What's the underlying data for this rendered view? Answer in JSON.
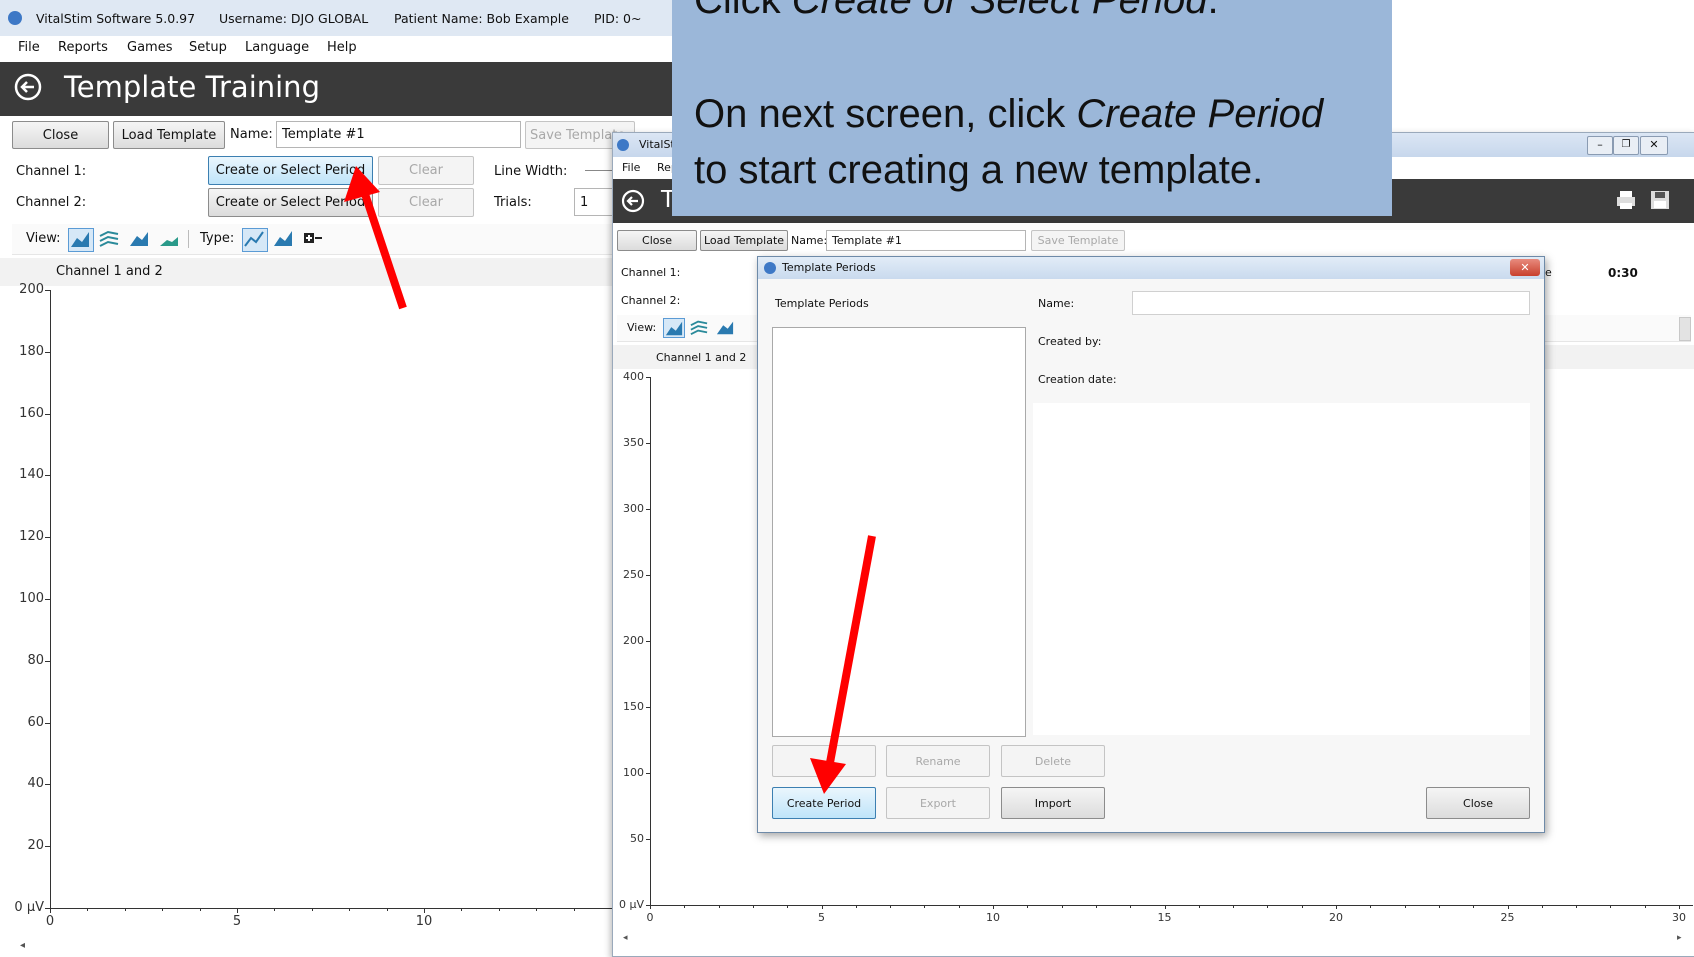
{
  "main_window": {
    "title_bar": {
      "app": "VitalStim Software 5.0.97",
      "username": "Username: DJO GLOBAL",
      "patient": "Patient Name: Bob Example",
      "pid": "PID: 0~"
    },
    "menu": [
      "File",
      "Reports",
      "Games",
      "Setup",
      "Language",
      "Help"
    ],
    "page_title": "Template Training",
    "toolbar": {
      "close": "Close",
      "load_template": "Load Template",
      "name_label": "Name:",
      "name_value": "Template #1",
      "save_template": "Save Template"
    },
    "channels": {
      "channel1_label": "Channel 1:",
      "channel2_label": "Channel 2:",
      "create_select_1": "Create or Select Period",
      "create_select_2": "Create or Select Period",
      "clear": "Clear",
      "line_width_label": "Line Width:",
      "trials_label": "Trials:",
      "trials_value": "1"
    },
    "view_label": "View:",
    "type_label": "Type:",
    "chart": {
      "title": "Channel 1 and 2",
      "y_ticks": [
        "200",
        "180",
        "160",
        "140",
        "120",
        "100",
        "80",
        "60",
        "40",
        "20",
        "0 µV"
      ],
      "x_ticks": [
        "0",
        "5",
        "10"
      ],
      "ylim": [
        0,
        200
      ]
    }
  },
  "second_window": {
    "title": "VitalSt",
    "menu": [
      "File",
      "Rep"
    ],
    "page_title": "T",
    "toolbar": {
      "close": "Close",
      "load_template": "Load Template",
      "name_label": "Name:",
      "name_value": "Template #1",
      "save_template": "Save Template"
    },
    "channel1_label": "Channel 1:",
    "channel2_label": "Channel 2:",
    "view_label": "View:",
    "timer": "0:30",
    "right_partial": "e",
    "chart": {
      "title": "Channel 1 and 2",
      "y_ticks": [
        "400",
        "350",
        "300",
        "250",
        "200",
        "150",
        "100",
        "50",
        "0 µV"
      ],
      "x_ticks": [
        "0",
        "5",
        "10",
        "15",
        "20",
        "25",
        "30"
      ],
      "ylim": [
        0,
        400
      ],
      "xlim": [
        0,
        30
      ]
    }
  },
  "dialog": {
    "title": "Template Periods",
    "list_header": "Template Periods",
    "name_label": "Name:",
    "created_by_label": "Created by:",
    "creation_date_label": "Creation date:",
    "buttons": {
      "rename": "Rename",
      "delete": "Delete",
      "create_period": "Create Period",
      "export": "Export",
      "import": "Import",
      "close": "Close"
    }
  },
  "callout": {
    "line1_prefix": "Click ",
    "line1_em": "Create or Select Period",
    "line1_suffix": ".",
    "line2_prefix": "On next screen, click ",
    "line2_em": "Create Period",
    "line3": "to start creating a new template."
  },
  "colors": {
    "dark_header": "#3a3a3a",
    "callout_bg": "#9bb7d9",
    "arrow": "#ff0000",
    "blue_button": "#bfe4f9"
  }
}
